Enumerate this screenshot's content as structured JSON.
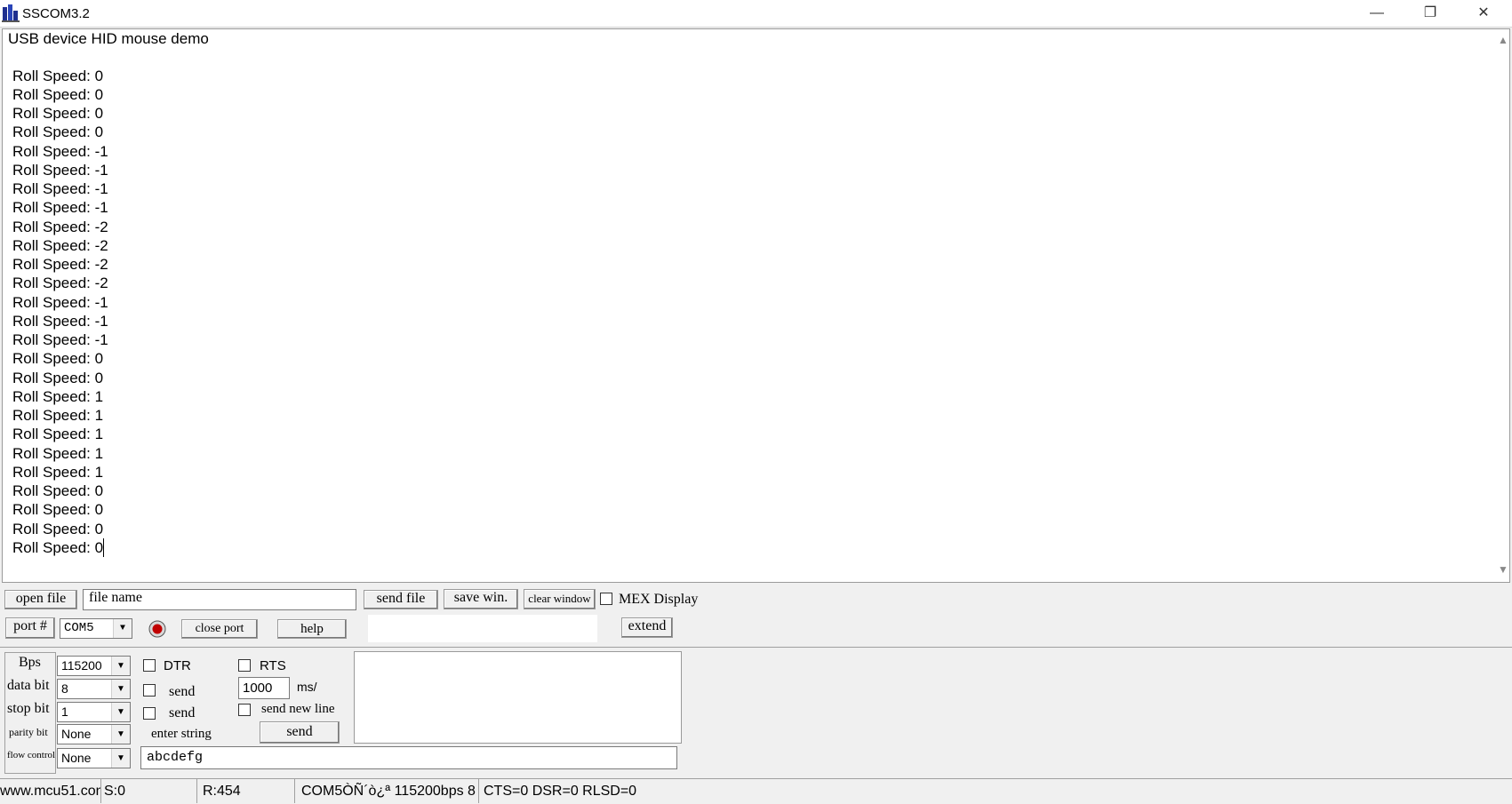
{
  "window": {
    "title": "SSCOM3.2",
    "min": "—",
    "max": "❐",
    "close": "✕"
  },
  "output": {
    "lines": [
      "USB device HID mouse demo",
      "",
      "Roll Speed: 0",
      "Roll Speed: 0",
      "Roll Speed: 0",
      "Roll Speed: 0",
      "Roll Speed: -1",
      "Roll Speed: -1",
      "Roll Speed: -1",
      "Roll Speed: -1",
      "Roll Speed: -2",
      "Roll Speed: -2",
      "Roll Speed: -2",
      "Roll Speed: -2",
      "Roll Speed: -1",
      "Roll Speed: -1",
      "Roll Speed: -1",
      "Roll Speed: 0",
      "Roll Speed: 0",
      "Roll Speed: 1",
      "Roll Speed: 1",
      "Roll Speed: 1",
      "Roll Speed: 1",
      "Roll Speed: 1",
      "Roll Speed: 0",
      "Roll Speed: 0",
      "Roll Speed: 0",
      "Roll Speed: 0"
    ]
  },
  "toolbar": {
    "open_file": "open file",
    "file_name": "file name",
    "send_file": "send file",
    "save_win": "save win.",
    "clear_window": "clear window",
    "hex_display": "MEX Display",
    "port_label": "port #",
    "port_value": "COM5",
    "close_port": "close port",
    "help": "help",
    "extend": "extend"
  },
  "settings": {
    "bps_label": "Bps",
    "bps_value": "115200",
    "data_bit_label": "data bit",
    "data_bit_value": "8",
    "stop_bit_label": "stop bit",
    "stop_bit_value": "1",
    "parity_label": "parity bit",
    "parity_value": "None",
    "flow_label": "flow control",
    "flow_value": "None",
    "dtr": "DTR",
    "rts": "RTS",
    "auto_send": "send",
    "interval": "1000",
    "interval_unit": "ms/",
    "hex_send": "send",
    "send_new_line": "send new line",
    "enter_string": "enter string",
    "send_button": "send",
    "input_value": "abcdefg"
  },
  "status": {
    "site": "www.mcu51.con",
    "sent": "S:0",
    "received": "R:454",
    "port_info": "COM5ÒÑ´ò¿ª  115200bps  8",
    "lines": "CTS=0 DSR=0 RLSD=0"
  },
  "colors": {
    "indicator": "#c00000",
    "background": "#f0f0f0"
  }
}
